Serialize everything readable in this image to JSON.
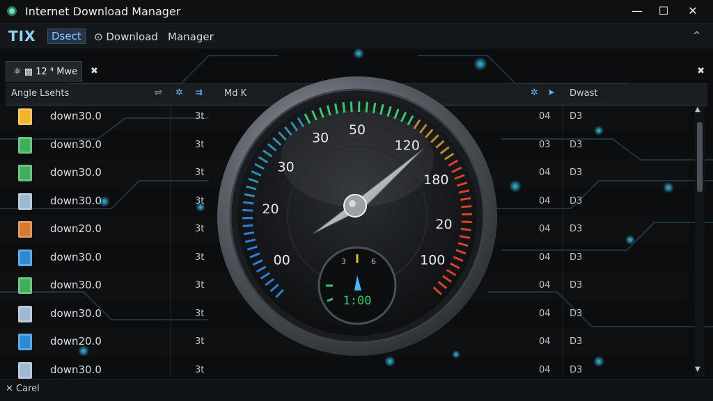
{
  "window": {
    "title": "Internet Download Manager",
    "minimize": "—",
    "maximize": "☐",
    "close": "✕"
  },
  "menu": {
    "logo": "TIX",
    "items": [
      "Dsect",
      "Download",
      "Manager"
    ],
    "collapse": "^"
  },
  "tab": {
    "label": "⚛ ▩ 12 ⁴ Mwe",
    "close": "✖",
    "panel_close": "✖"
  },
  "columns": {
    "name": "Angle Lsehts",
    "size": "Md K",
    "type": "Dwast"
  },
  "rows": [
    {
      "name": "down30.0",
      "c3": "3t",
      "c4": "04",
      "c5": "D3",
      "icon_color": "#f0b52b"
    },
    {
      "name": "down30.0",
      "c3": "3t",
      "c4": "03",
      "c5": "D3",
      "icon_color": "#3fae5a"
    },
    {
      "name": "down30.0",
      "c3": "3t",
      "c4": "04",
      "c5": "D3",
      "icon_color": "#3fae5a"
    },
    {
      "name": "down30.0",
      "c3": "3t",
      "c4": "04",
      "c5": "D3",
      "icon_color": "#9fb9d2"
    },
    {
      "name": "down20.0",
      "c3": "3t",
      "c4": "04",
      "c5": "D3",
      "icon_color": "#d47a2a"
    },
    {
      "name": "down30.0",
      "c3": "3t",
      "c4": "04",
      "c5": "D3",
      "icon_color": "#2f8ad6"
    },
    {
      "name": "down30.0",
      "c3": "3t",
      "c4": "04",
      "c5": "D3",
      "icon_color": "#3fae5a"
    },
    {
      "name": "down30.0",
      "c3": "3t",
      "c4": "04",
      "c5": "D3",
      "icon_color": "#9fb9d2"
    },
    {
      "name": "down20.0",
      "c3": "3t",
      "c4": "04",
      "c5": "D3",
      "icon_color": "#2f8ad6"
    },
    {
      "name": "down30.0",
      "c3": "3t",
      "c4": "04",
      "c5": "D3",
      "icon_color": "#9fb9d2"
    }
  ],
  "gauge": {
    "labels": [
      "00",
      "20",
      "30",
      "30",
      "50",
      "120",
      "180",
      "20",
      "100"
    ],
    "digital": "1:00",
    "sub_labels": [
      "3",
      "6"
    ]
  },
  "status": {
    "text": "✕ Carel"
  },
  "colors": {
    "accent": "#5db6ff",
    "green": "#3cc86a",
    "red": "#d8432c",
    "blue": "#2e7fd6"
  }
}
